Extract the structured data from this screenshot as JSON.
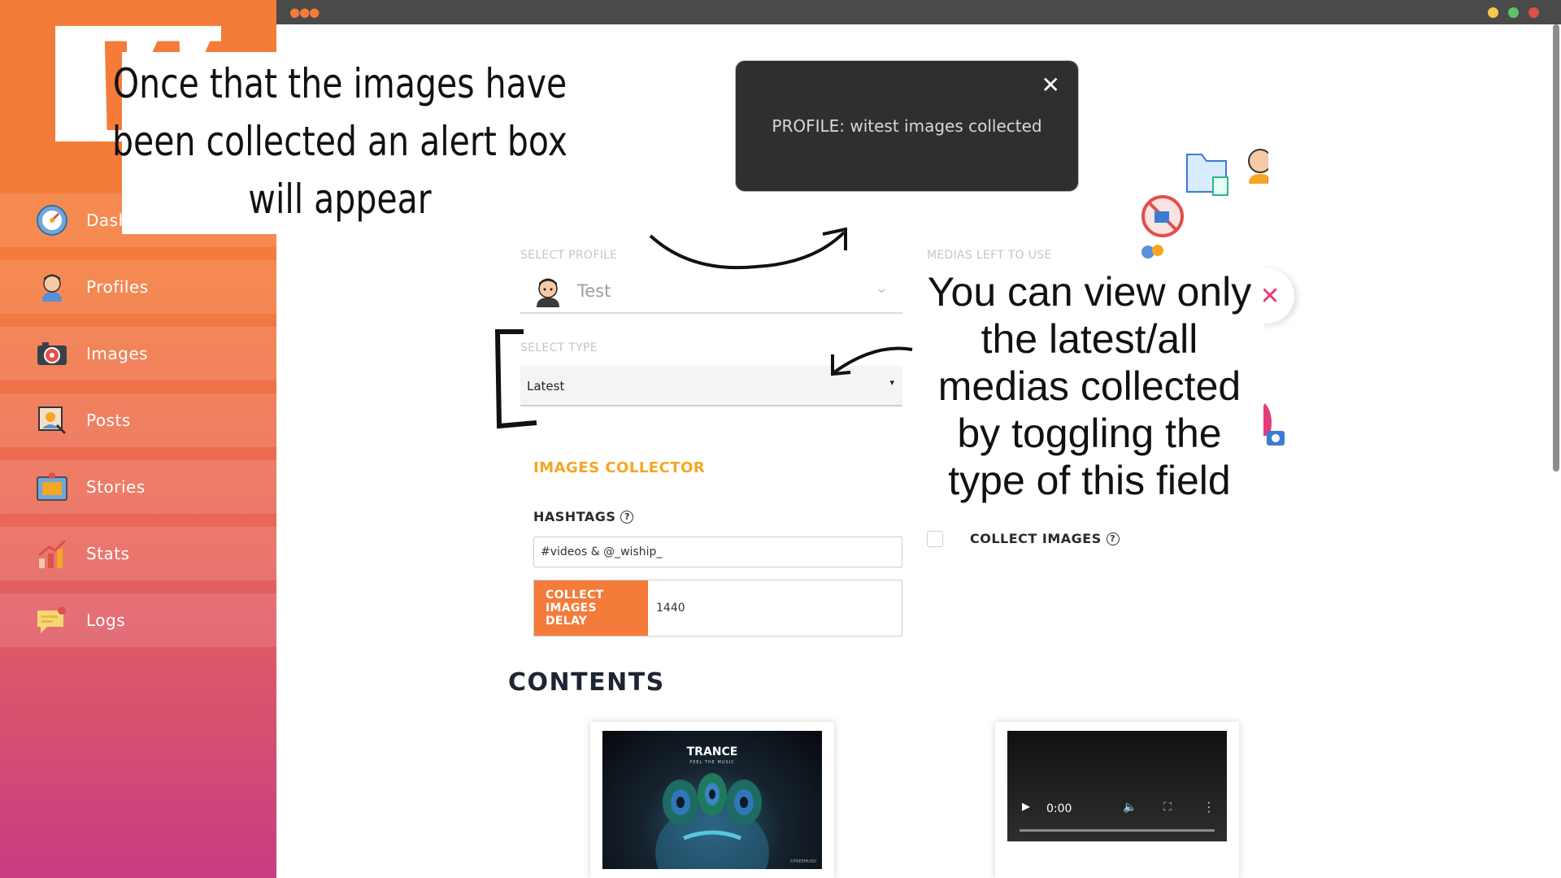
{
  "sidebar": {
    "logo_letter": "W",
    "items": [
      {
        "label": "Dashboard",
        "icon": "dashboard-gauge-icon"
      },
      {
        "label": "Profiles",
        "icon": "user-avatar-icon"
      },
      {
        "label": "Images",
        "icon": "camera-icon"
      },
      {
        "label": "Posts",
        "icon": "photo-post-icon"
      },
      {
        "label": "Stories",
        "icon": "story-frame-icon"
      },
      {
        "label": "Stats",
        "icon": "bar-chart-icon"
      },
      {
        "label": "Logs",
        "icon": "chat-notification-icon"
      }
    ]
  },
  "annotations": {
    "top_left": "Once that the images have been collected an alert box will appear",
    "right": "You can view only the latest/all medias collected by toggling the type of this field"
  },
  "toast": {
    "message": "PROFILE: witest images collected",
    "close_icon": "close-icon"
  },
  "form": {
    "select_profile_label": "SELECT PROFILE",
    "profile_value": "Test",
    "medias_left_label": "MEDIAS LEFT TO USE",
    "select_type_label": "SELECT TYPE",
    "type_value": "Latest",
    "section_title": "IMAGES COLLECTOR",
    "hashtags_label": "HASHTAGS",
    "hashtags_value": "#videos & @_wiship_",
    "delay_label": "COLLECT IMAGES DELAY",
    "delay_value": "1440",
    "collect_images_label": "COLLECT IMAGES",
    "collect_images_checked": false
  },
  "contents": {
    "title": "CONTENTS",
    "cards": [
      {
        "type": "image",
        "title": "TRANCE",
        "subtitle": "FEEL THE MUSIC",
        "credit": "©FREEMUSIC"
      },
      {
        "type": "video",
        "time": "0:00"
      }
    ]
  },
  "colors": {
    "accent": "#f47b3a",
    "section_title": "#f5a623",
    "gradient_end": "#c83c82",
    "close_pink": "#e83b7a"
  }
}
